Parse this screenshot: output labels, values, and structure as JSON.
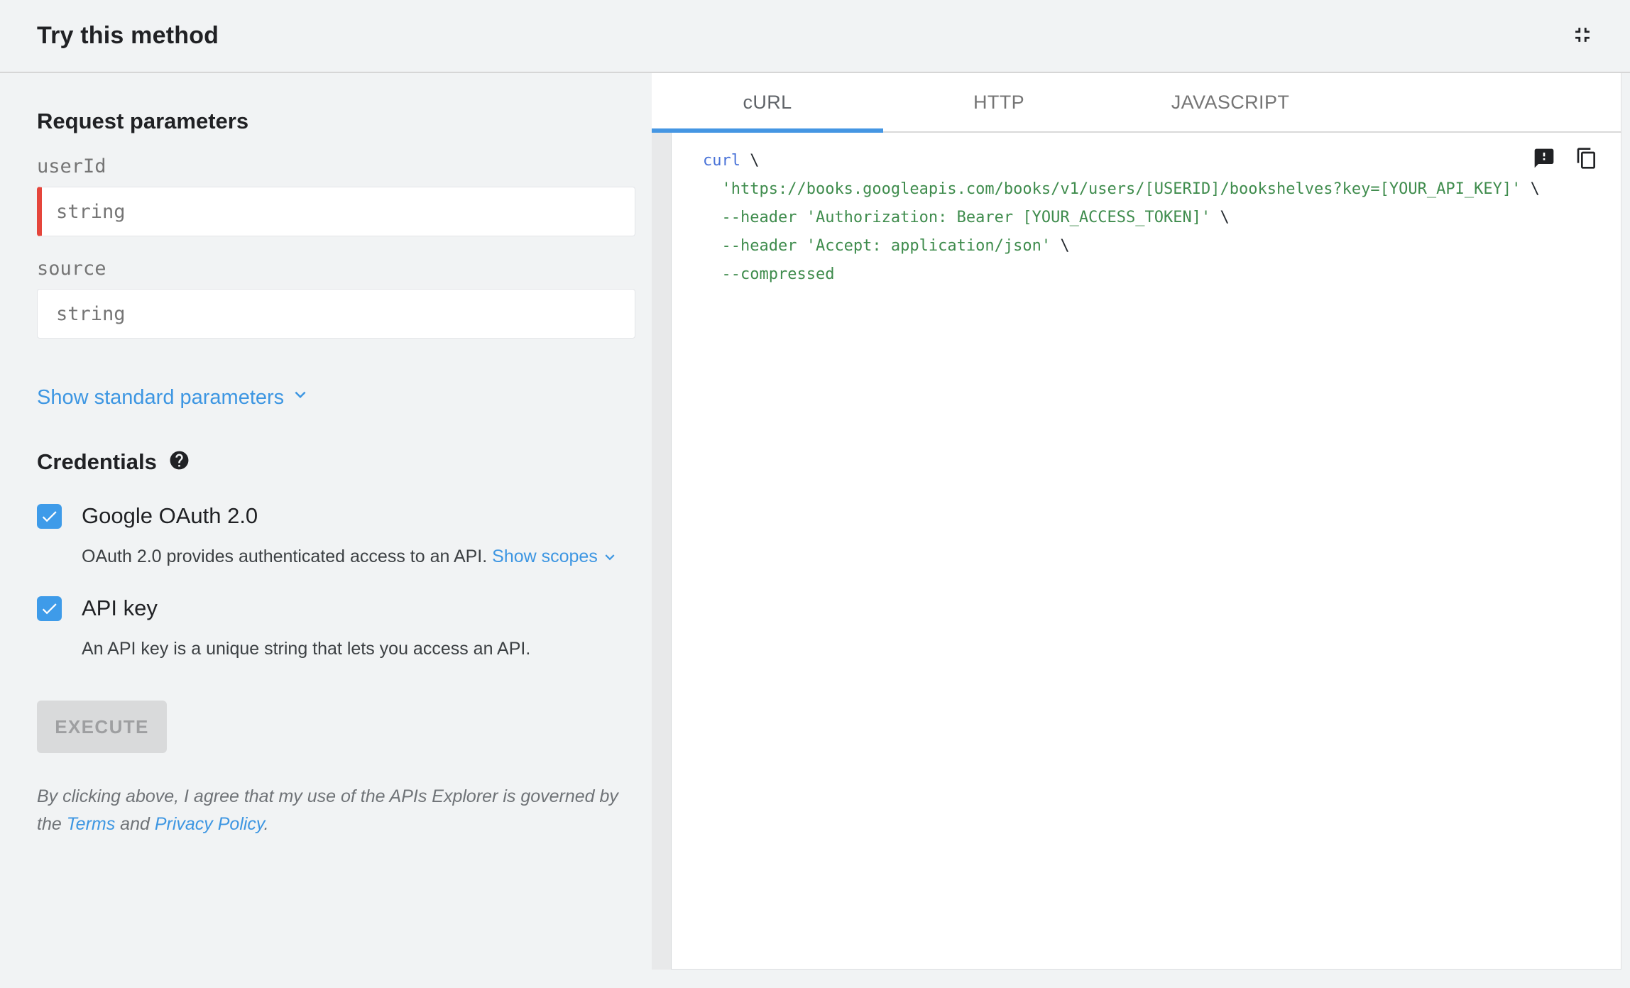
{
  "header": {
    "title": "Try this method",
    "collapse_icon": "fullscreen-exit-icon"
  },
  "request_parameters": {
    "heading": "Request parameters",
    "fields": [
      {
        "label": "userId",
        "placeholder": "string",
        "value": "",
        "required": true
      },
      {
        "label": "source",
        "placeholder": "string",
        "value": "",
        "required": false
      }
    ],
    "show_standard_parameters_label": "Show standard parameters"
  },
  "credentials": {
    "heading": "Credentials",
    "help_icon": "help-icon",
    "options": [
      {
        "label": "Google OAuth 2.0",
        "checked": true,
        "description": "OAuth 2.0 provides authenticated access to an API. ",
        "link_label": "Show scopes"
      },
      {
        "label": "API key",
        "checked": true,
        "description": "An API key is a unique string that lets you access an API."
      }
    ]
  },
  "execute_button": {
    "label": "EXECUTE",
    "enabled": false
  },
  "disclaimer": {
    "prefix": "By clicking above, I agree that my use of the APIs Explorer is governed by the ",
    "terms_label": "Terms",
    "middle": " and ",
    "privacy_label": "Privacy Policy",
    "suffix": "."
  },
  "code_panel": {
    "tabs": [
      {
        "label": "cURL",
        "active": true
      },
      {
        "label": "HTTP",
        "active": false
      },
      {
        "label": "JAVASCRIPT",
        "active": false
      }
    ],
    "action_icons": [
      "feedback-icon",
      "copy-icon"
    ],
    "code_lines": [
      [
        {
          "t": "curl",
          "c": "kwd"
        },
        {
          "t": " \\",
          "c": "pln"
        }
      ],
      [
        {
          "t": "  ",
          "c": "pln"
        },
        {
          "t": "'https://books.googleapis.com/books/v1/users/[USERID]/bookshelves?key=[YOUR_API_KEY]'",
          "c": "str"
        },
        {
          "t": " \\",
          "c": "pln"
        }
      ],
      [
        {
          "t": "  ",
          "c": "pln"
        },
        {
          "t": "--header 'Authorization: Bearer [YOUR_ACCESS_TOKEN]'",
          "c": "str"
        },
        {
          "t": " \\",
          "c": "pln"
        }
      ],
      [
        {
          "t": "  ",
          "c": "pln"
        },
        {
          "t": "--header 'Accept: application/json'",
          "c": "str"
        },
        {
          "t": " \\",
          "c": "pln"
        }
      ],
      [
        {
          "t": "  ",
          "c": "pln"
        },
        {
          "t": "--compressed",
          "c": "str"
        }
      ]
    ]
  },
  "colors": {
    "link-blue": "#3d96e2",
    "checkbox-blue": "#3e9be9",
    "tab-underline": "#4596e3",
    "required-red": "#e5453b",
    "code-keyword": "#4a73d8",
    "code-string": "#3f8c4d"
  }
}
